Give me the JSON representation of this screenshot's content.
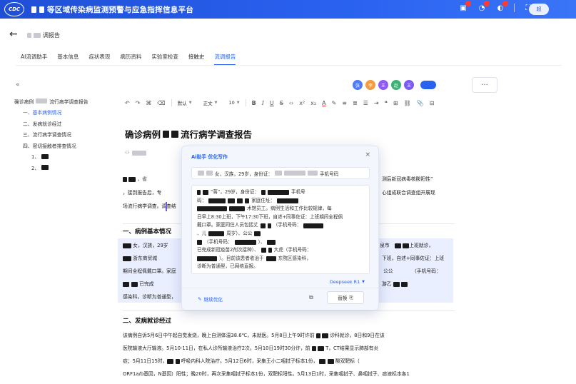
{
  "app": {
    "logo_text": "CDC",
    "title": "等区域传染病监测预警与应急指挥信息平台",
    "user_label": "超"
  },
  "header": {
    "back_icon": "arrow-left-icon",
    "page_title": "调报告"
  },
  "tabs": [
    {
      "label": "AI流调助手",
      "active": false
    },
    {
      "label": "基本信息",
      "active": false
    },
    {
      "label": "症状表现",
      "active": false
    },
    {
      "label": "病历资料",
      "active": false
    },
    {
      "label": "实验室检查",
      "active": false
    },
    {
      "label": "接触史",
      "active": false
    },
    {
      "label": "流调报告",
      "active": true
    }
  ],
  "outline": {
    "root": "确诊病例",
    "root_suffix": "流行病学调查报告",
    "items": [
      {
        "label": "一、基本病例情况",
        "level": 1,
        "active": true
      },
      {
        "label": "二、发病就诊经过",
        "level": 1,
        "active": false
      },
      {
        "label": "三、流行病学调查情况",
        "level": 1,
        "active": false
      },
      {
        "label": "四、密切接触者排查情况",
        "level": 1,
        "active": false
      },
      {
        "label": "1、",
        "level": 2,
        "active": false
      },
      {
        "label": "2、",
        "level": 2,
        "active": false
      }
    ]
  },
  "collaborators": [
    {
      "initial": "张",
      "color": "#4f7cf5"
    },
    {
      "initial": "李",
      "color": "#f39c3c"
    },
    {
      "initial": "王",
      "color": "#8e5cf0"
    },
    {
      "initial": "赵",
      "color": "#3bb273"
    },
    {
      "initial": "王",
      "color": "#7a5cf0"
    }
  ],
  "toolbar": {
    "font_family": "默认",
    "paragraph": "正文",
    "font_size": "10"
  },
  "document": {
    "title_prefix": "确诊病例",
    "title_suffix": "流行病学调查报告",
    "intro_line1_tail": "测后新冠病毒核酸阳性”",
    "intro_line2_start": "，接到报告后，专",
    "intro_line2_tail": "心组成联合调查组开展现",
    "intro_line3_start": "场流行病学调查。调查结",
    "section1_heading": "一、病例基本情况",
    "s1_line1": "女，汉族，29岁",
    "s1_line1_right": "泉市",
    "s1_line1_far": "上班就诊，",
    "s1_line2": "浙东商贸城",
    "s1_line2_right": "下班，自述+同事佐证：上班",
    "s1_line3": "期间全程佩戴口罩。家庭",
    "s1_line3_right": "公公",
    "s1_line3_far": "（手机号码：",
    "s1_line4": "已完成",
    "s1_line4_right": "游乙",
    "s1_line5": "感染科，诊断为普通型，",
    "section2_heading": "二、发病就诊经过",
    "s2_line1": "该病例自诉5月6日中午起自觉发烧，晚上自测体温38.6℃，未就医。5月8日上午9时许前",
    "s2_line1_tail": "诊科就诊，8日和9日在该",
    "s2_line2": "医院输液大厅输液。5月10-11日，在私人诊所输液治疗2次。5月10日19时30分许，前",
    "s2_line2_tail": "T，CT结果显示肺部有炎",
    "s2_line3": "症；5月11日15时，",
    "s2_line3_mid": "呼吸内科入院治疗。5月12日6时，采集王小二咽拭子标本1份，",
    "s2_line3_tail": "酸双靶标（",
    "s2_line4": "ORF1a/b基因，N基因）阳性；晚20时，再次采集咽拭子标本1份，双靶标阳性。5月13日1时，采集咽拭子、鼻咽拭子、痰液标本各1"
  },
  "ai_dialog": {
    "title": "Ai助手 优化写作",
    "prompt_line": "女，汉族，29岁，身份证：",
    "prompt_tail": "手机号码",
    "content": [
      {
        "pre": "",
        "text": "“蒋”，29岁，身份证：",
        "tail": "手机号"
      },
      {
        "pre": "码：",
        "text": "",
        "tail": "家庭住址："
      },
      {
        "pre": "",
        "text": "",
        "tail": "术馆员工。病例生活和工作比较规律，每"
      },
      {
        "pre": "",
        "text": "日早上8:30上班，下午17:30下班，自述+同事佐证：上班期间全程佩",
        "tail": ""
      },
      {
        "pre": "",
        "text": "戴口罩。家庭同住人员包括丈",
        "tail": "（手机号码："
      },
      {
        "pre": "",
        "text": "、儿",
        "tail": "周岁）、公公"
      },
      {
        "pre": "",
        "text": "（手机号码：",
        "tail": "）、"
      },
      {
        "pre": "",
        "text": "已完成新冠疫苗2剂次接种）、",
        "tail": "大虎（手机号码："
      },
      {
        "pre": "",
        "text": "）。目前该患者收治于",
        "tail": "东院区感染科，"
      },
      {
        "pre": "",
        "text": "诊断为普通型，已网络直报。",
        "tail": ""
      }
    ],
    "model": "Deepseek R1",
    "continue_label": "继续优化",
    "replace_label": "替换"
  }
}
